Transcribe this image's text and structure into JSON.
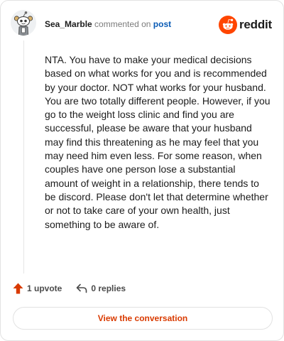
{
  "header": {
    "username": "Sea_Marble",
    "action_text": "commented on",
    "post_link": "post"
  },
  "brand": {
    "wordmark": "reddit",
    "logo_icon": "reddit-snoo-icon",
    "color": "#ff4500"
  },
  "comment": {
    "body": "NTA. You have to make your medical decisions based on what works for you and is recommended by your doctor. NOT what works for your husband. You are two totally different people. However, if you go to the weight loss clinic and find you are successful, please be aware that your husband may find this threatening as he may feel that you may need him even less. For some reason, when couples have one person lose a substantial amount of weight in a relationship, there tends to be discord. Please don't let that determine whether or not to take care of your own health, just something to be aware of."
  },
  "actions": {
    "upvote_label": "1 upvote",
    "upvote_icon": "upvote-arrow-icon",
    "upvote_color": "#d93a00",
    "replies_label": "0 replies",
    "replies_icon": "reply-arrow-icon"
  },
  "cta": {
    "view_label": "View the conversation",
    "color": "#d93a00"
  }
}
